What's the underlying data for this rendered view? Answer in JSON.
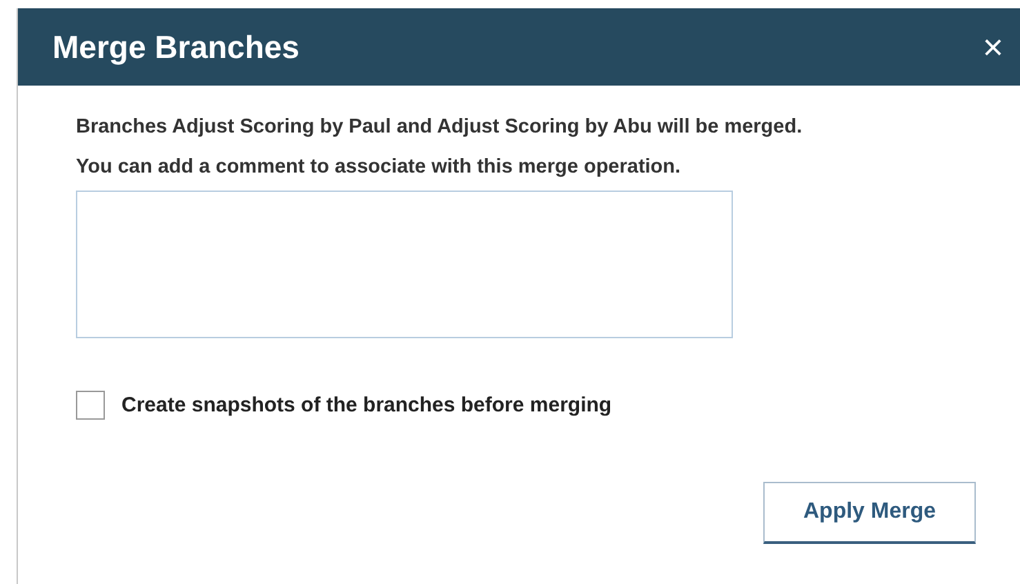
{
  "dialog": {
    "title": "Merge Branches",
    "close": "×"
  },
  "messages": [
    "Branches Adjust Scoring by Paul and Adjust Scoring by Abu will be merged.",
    "You can add a comment to associate with this merge operation."
  ],
  "snapshot_option": {
    "label": "Create snapshots of the branches before merging",
    "checked": false
  },
  "buttons": [
    "Apply Merge"
  ]
}
